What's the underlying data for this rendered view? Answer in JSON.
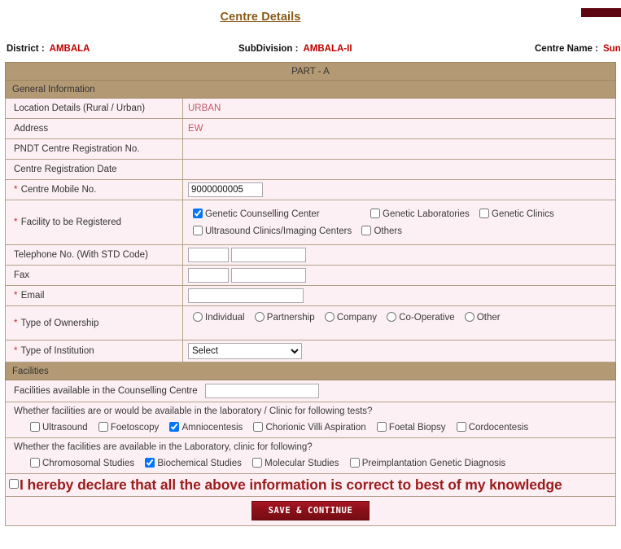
{
  "page": {
    "title": "Centre Details",
    "part_label": "PART - A"
  },
  "info_bar": {
    "district_label": "District :",
    "district_value": "AMBALA",
    "subdivision_label": "SubDivision :",
    "subdivision_value": "AMBALA-II",
    "centre_label": "Centre Name :",
    "centre_value": "Sunil"
  },
  "general": {
    "section_title": "General Information",
    "location_label": "Location Details (Rural / Urban)",
    "location_value": "URBAN",
    "address_label": "Address",
    "address_value": "EW",
    "pndt_label": "PNDT Centre Registration No.",
    "pndt_value": "",
    "regdate_label": "Centre Registration Date",
    "regdate_value": "",
    "mobile_label": "Centre Mobile No.",
    "mobile_value": "9000000005",
    "facility_label": "Facility to be Registered",
    "facility_options": [
      {
        "label": "Genetic Counselling Center",
        "checked": true
      },
      {
        "label": "Genetic Laboratories",
        "checked": false
      },
      {
        "label": "Genetic Clinics",
        "checked": false
      },
      {
        "label": "Ultrasound Clinics/Imaging Centers",
        "checked": false
      },
      {
        "label": "Others",
        "checked": false
      }
    ],
    "telephone_label": "Telephone No. (With STD Code)",
    "telephone_std_value": "",
    "telephone_value": "",
    "fax_label": "Fax",
    "fax_std_value": "",
    "fax_value": "",
    "email_label": "Email",
    "email_value": "",
    "ownership_label": "Type of Ownership",
    "ownership_options": [
      {
        "label": "Individual",
        "checked": false
      },
      {
        "label": "Partnership",
        "checked": false
      },
      {
        "label": "Company",
        "checked": false
      },
      {
        "label": "Co-Operative",
        "checked": false
      },
      {
        "label": "Other",
        "checked": false
      }
    ],
    "institution_label": "Type of Institution",
    "institution_selected": "Select"
  },
  "facilities": {
    "section_title": "Facilities",
    "counselling_label": "Facilities available in the Counselling Centre",
    "counselling_value": "",
    "tests_question": "Whether facilities are or would be available in the laboratory / Clinic for following tests?",
    "tests_options": [
      {
        "label": "Ultrasound",
        "checked": false
      },
      {
        "label": "Foetoscopy",
        "checked": false
      },
      {
        "label": "Amniocentesis",
        "checked": true
      },
      {
        "label": "Chorionic Villi Aspiration",
        "checked": false
      },
      {
        "label": "Foetal Biopsy",
        "checked": false
      },
      {
        "label": "Cordocentesis",
        "checked": false
      }
    ],
    "lab_question": "Whether the facilities are available in the Laboratory, clinic for following?",
    "lab_options": [
      {
        "label": "Chromosomal Studies",
        "checked": false
      },
      {
        "label": "Biochemical Studies",
        "checked": true
      },
      {
        "label": "Molecular Studies",
        "checked": false
      },
      {
        "label": "Preimplantation Genetic Diagnosis",
        "checked": false
      }
    ]
  },
  "declaration": {
    "text": "I hereby declare that all the above information is correct to best of my knowledge",
    "checked": false
  },
  "actions": {
    "save_label": "SAVE & CONTINUE"
  },
  "colors": {
    "band": "#b49a74",
    "row_bg": "#fdf0f4",
    "accent_red": "#c00000",
    "title_brown": "#8a5a18",
    "button_red": "#8c1019",
    "top_bar": "#5c0712"
  }
}
